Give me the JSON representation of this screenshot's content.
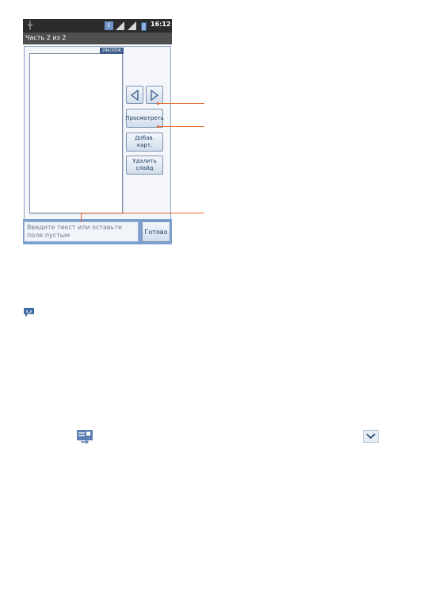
{
  "status_bar": {
    "network": "E",
    "time": "16:12"
  },
  "title_bar": {
    "title": "Часть 2 из 2"
  },
  "slide": {
    "size_badge": "29K/300K"
  },
  "buttons": {
    "preview": "Просмотреть",
    "add_card": "Добав. карт.",
    "delete_slide": "Удалить слайд",
    "done": "Готово"
  },
  "input": {
    "placeholder": "Введите текст или оставьте поле пустым"
  },
  "colors": {
    "accent": "#e46a2a",
    "status_bar": "#2b2b2b",
    "title_bar": "#4f4f4f",
    "input_bar": "#7aa0d3"
  },
  "icons": [
    "usb-icon",
    "signal-icon",
    "battery-icon",
    "arrow-left-icon",
    "arrow-right-icon",
    "chat-icon",
    "send-icon",
    "chevron-down-icon"
  ]
}
